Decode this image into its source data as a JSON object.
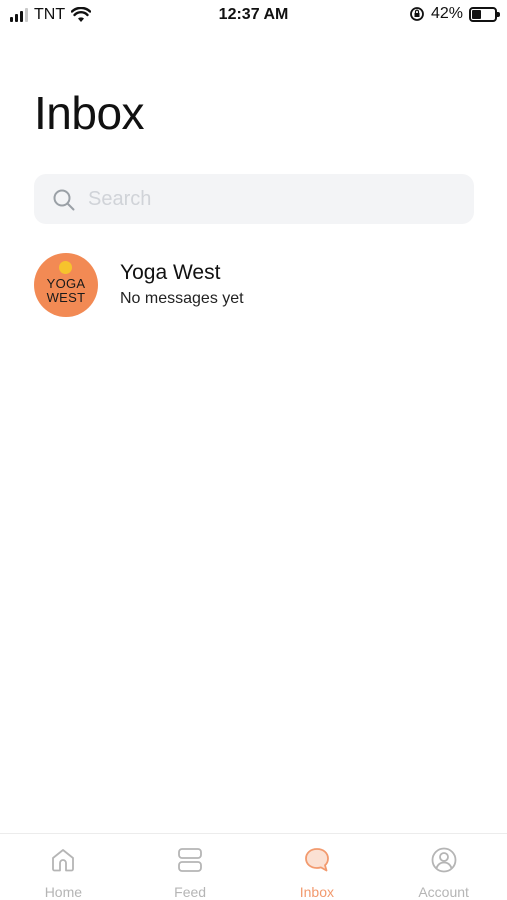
{
  "status_bar": {
    "carrier": "TNT",
    "time": "12:37 AM",
    "battery_percent": "42%",
    "battery_level": 0.42
  },
  "page": {
    "title": "Inbox"
  },
  "search": {
    "placeholder": "Search",
    "value": ""
  },
  "conversations": [
    {
      "name": "Yoga West",
      "preview": "No messages yet",
      "avatar_line1": "YOGA",
      "avatar_line2": "WEST",
      "avatar_color": "#f28a54",
      "avatar_sun_color": "#f6c32d"
    }
  ],
  "bottom_nav": {
    "items": [
      {
        "label": "Home",
        "icon": "home-icon"
      },
      {
        "label": "Feed",
        "icon": "feed-icon"
      },
      {
        "label": "Inbox",
        "icon": "chat-bubble-icon",
        "active": true
      },
      {
        "label": "Account",
        "icon": "user-circle-icon"
      }
    ],
    "active_color": "#f29a6e",
    "inactive_color": "#b5b5b5"
  }
}
